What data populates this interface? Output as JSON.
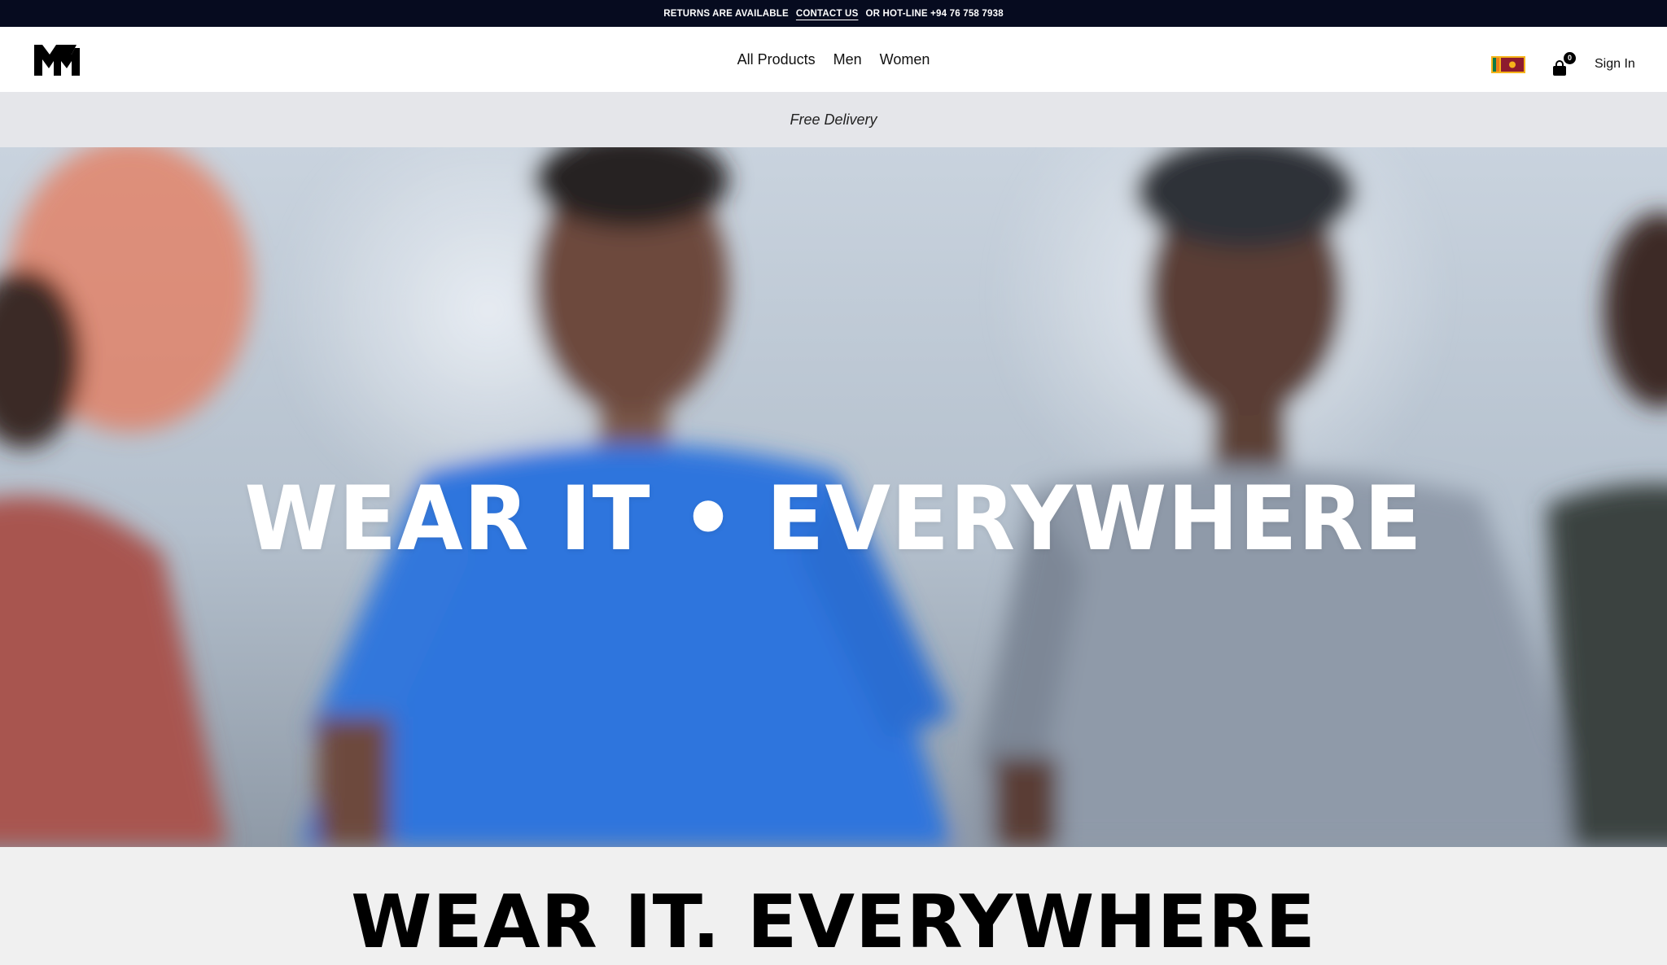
{
  "announcement": {
    "left_text": "RETURNS ARE AVAILABLE",
    "contact_link": "CONTACT US",
    "right_text": "OR HOT-LINE +94 76 758 7938"
  },
  "header": {
    "logo_icon": "brand-m-logo-icon",
    "nav": [
      "All Products",
      "Men",
      "Women"
    ],
    "country_flag_icon": "sri-lanka-flag-icon",
    "cart_icon": "shopping-bag-icon",
    "cart_count": "0",
    "sign_in": "Sign In"
  },
  "promo": {
    "text": "Free Delivery"
  },
  "hero": {
    "title": "WEAR IT • EVERYWHERE",
    "image": "hero-models-photo"
  },
  "section": {
    "title": "WEAR IT. EVERYWHERE"
  },
  "colors": {
    "topbar_bg": "#060b1f",
    "promo_bg": "#e5e6ea",
    "page_bg": "#f0f0f0"
  }
}
